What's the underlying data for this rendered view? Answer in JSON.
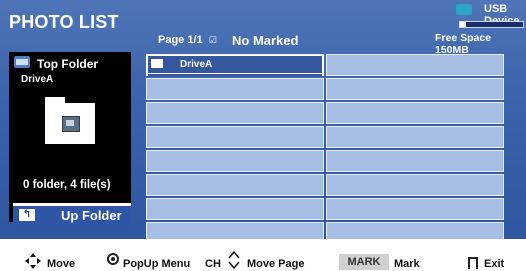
{
  "header": {
    "title": "PHOTO LIST",
    "page_info": "Page 1/1",
    "page_checkbox": "☑",
    "marked_status": "No Marked"
  },
  "device": {
    "name": "USB Device",
    "free_space": "Free Space 150MB",
    "used_fraction": 0.1
  },
  "left_panel": {
    "top_folder_label": "Top Folder",
    "current_folder": "DriveA",
    "file_count": "0 folder, 4 file(s)",
    "up_folder_label": "Up Folder",
    "up_icon_glyph": "↰"
  },
  "grid": {
    "selected_label": "DriveA",
    "columns": 2,
    "rows": 9
  },
  "footer": {
    "move": "Move",
    "popup": "PopUp Menu",
    "ch": "CH",
    "move_page": "Move Page",
    "mark_key": "MARK",
    "mark": "Mark",
    "exit": "Exit"
  },
  "colors": {
    "background_blue": "#3c63ab",
    "cell": "#a6bee3",
    "selected_bar": "#34579e"
  }
}
